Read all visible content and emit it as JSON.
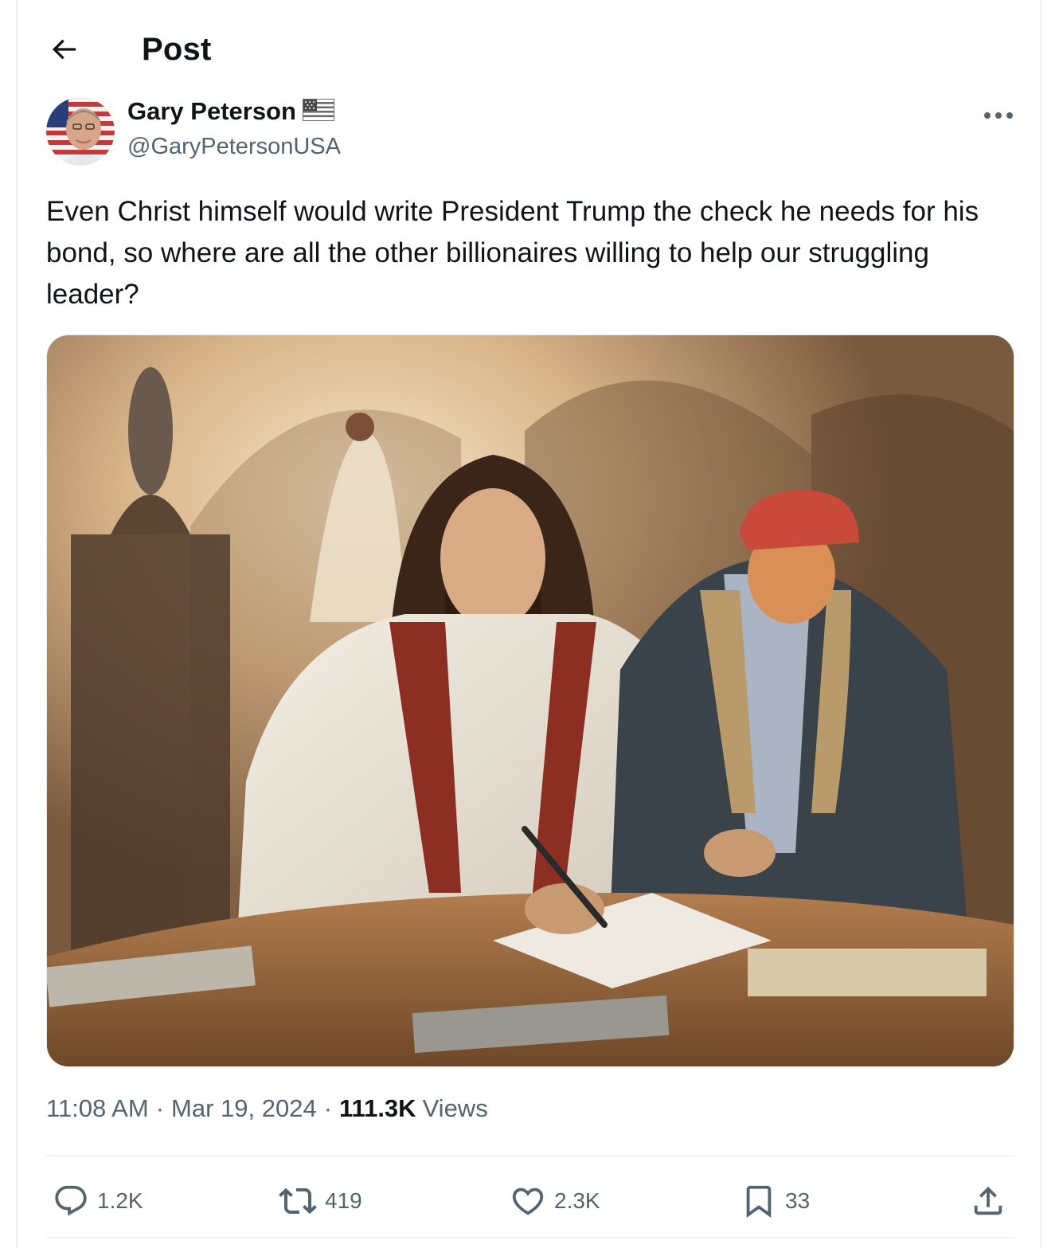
{
  "header": {
    "title": "Post"
  },
  "author": {
    "name": "Gary Peterson",
    "handle": "@GaryPetersonUSA"
  },
  "tweet": {
    "text": "Even Christ himself would write President Trump the check he needs for his bond, so where are all the other billionaires willing to help our struggling leader?"
  },
  "meta": {
    "time": "11:08 AM",
    "date": "Mar 19, 2024",
    "views_count": "111.3K",
    "views_label": "Views",
    "separator": "·"
  },
  "actions": {
    "reply_count": "1.2K",
    "retweet_count": "419",
    "like_count": "2.3K",
    "bookmark_count": "33"
  },
  "icons": {
    "back": "arrow-left-icon",
    "more": "more-horizontal-icon",
    "reply": "reply-icon",
    "retweet": "retweet-icon",
    "like": "heart-icon",
    "bookmark": "bookmark-icon",
    "share": "share-icon"
  },
  "colors": {
    "text": "#0f1419",
    "secondary": "#536471",
    "border": "#eff3f4"
  }
}
